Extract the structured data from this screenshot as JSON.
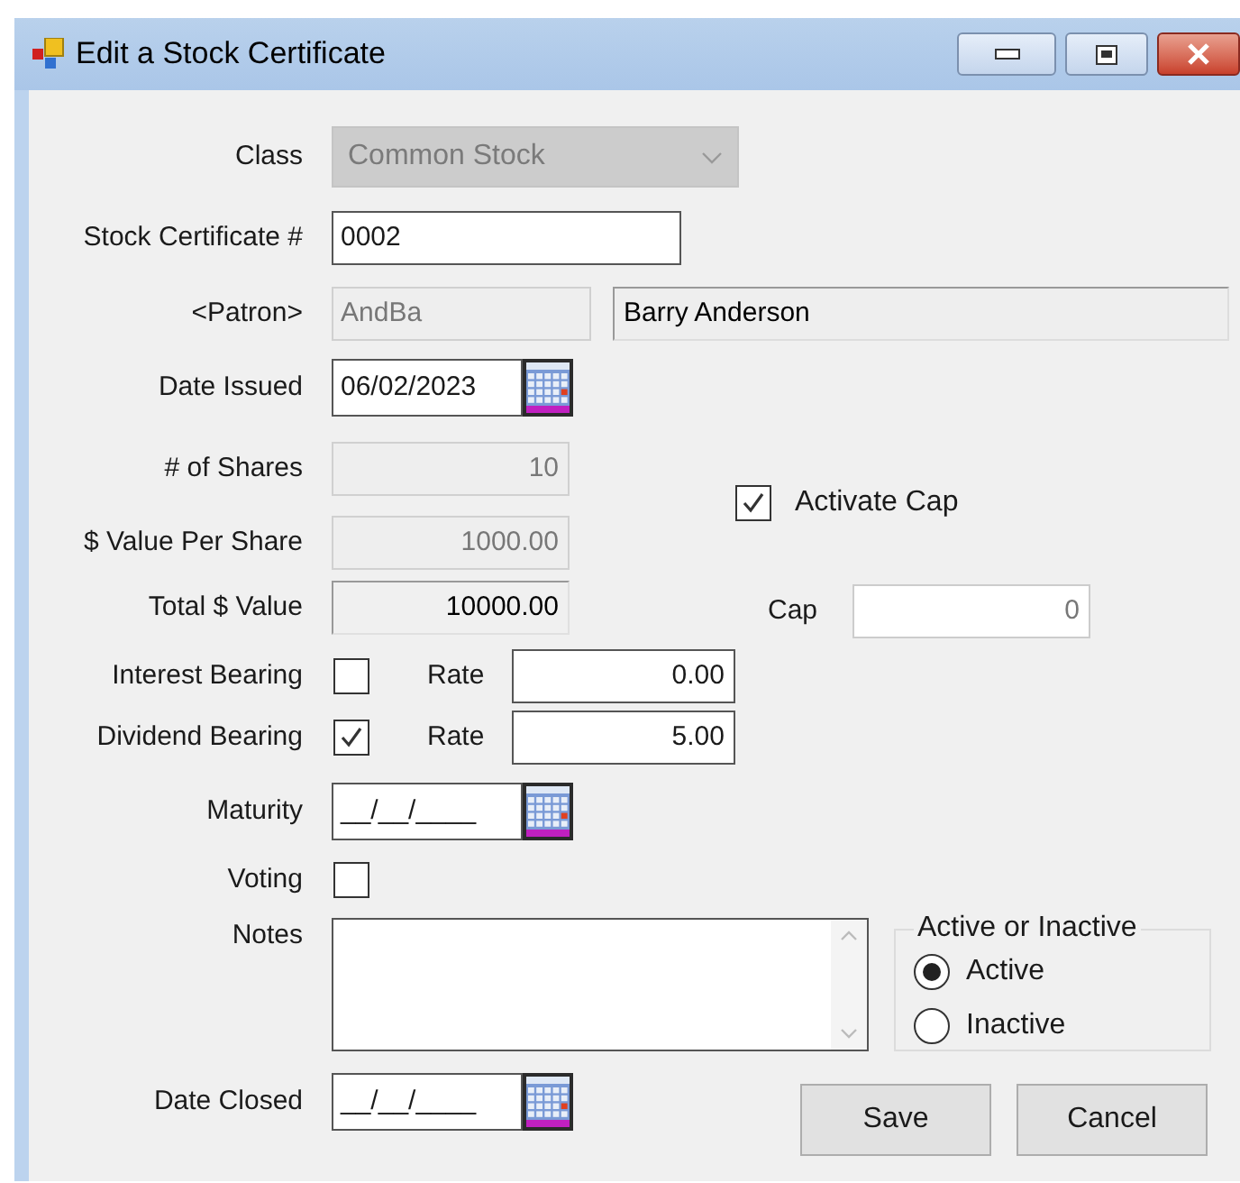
{
  "window": {
    "title": "Edit a Stock Certificate"
  },
  "class": {
    "label": "Class",
    "value": "Common Stock",
    "disabled": true
  },
  "stock_certificate": {
    "label": "Stock Certificate #",
    "value": "0002"
  },
  "patron": {
    "label": "<Patron>",
    "code": "AndBa",
    "name": "Barry Anderson"
  },
  "date_issued": {
    "label": "Date Issued",
    "value": "06/02/2023"
  },
  "shares": {
    "label": "# of Shares",
    "value": "10",
    "disabled": true
  },
  "value_per_share": {
    "label": "$ Value Per Share",
    "value": "1000.00",
    "disabled": true
  },
  "total_value": {
    "label": "Total $ Value",
    "value": "10000.00"
  },
  "bearing": [
    {
      "label": "Interest Bearing",
      "checked": false,
      "rate_label": "Rate",
      "rate": "0.00"
    },
    {
      "label": "Dividend Bearing",
      "checked": true,
      "rate_label": "Rate",
      "rate": "5.00"
    }
  ],
  "activate_cap": {
    "label": "Activate Cap",
    "checked": true
  },
  "cap": {
    "label": "Cap",
    "value": "0",
    "disabled": true
  },
  "maturity": {
    "label": "Maturity",
    "value": "__/__/____"
  },
  "voting": {
    "label": "Voting",
    "checked": false
  },
  "notes": {
    "label": "Notes"
  },
  "status_group": {
    "title": "Active or Inactive",
    "options": [
      {
        "label": "Active",
        "selected": true
      },
      {
        "label": "Inactive",
        "selected": false
      }
    ]
  },
  "date_closed": {
    "label": "Date Closed",
    "value": "__/__/____"
  },
  "buttons": [
    "Save",
    "Cancel"
  ]
}
